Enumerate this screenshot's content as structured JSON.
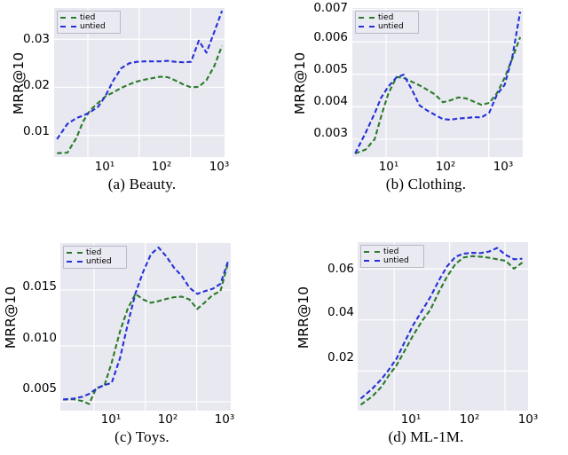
{
  "figure": {
    "subplots": [
      {
        "id": "a",
        "caption": "(a) Beauty.",
        "ylabel": "MRR@10",
        "yticks": [
          "0.01",
          "0.02",
          "0.03"
        ],
        "ytick_values": [
          0.01,
          0.02,
          0.03
        ],
        "xticks": [
          "10¹",
          "10²",
          "10³"
        ],
        "xtick_values": [
          10,
          100,
          1000
        ],
        "legend": [
          "tied",
          "untied"
        ]
      },
      {
        "id": "b",
        "caption": "(b) Clothing.",
        "ylabel": "MRR@10",
        "yticks": [
          "0.003",
          "0.004",
          "0.005",
          "0.006",
          "0.007"
        ],
        "ytick_values": [
          0.003,
          0.004,
          0.005,
          0.006,
          0.007
        ],
        "xticks": [
          "10¹",
          "10²",
          "10³"
        ],
        "xtick_values": [
          10,
          100,
          1000
        ],
        "legend": [
          "tied",
          "untied"
        ]
      },
      {
        "id": "c",
        "caption": "(c) Toys.",
        "ylabel": "MRR@10",
        "yticks": [
          "0.005",
          "0.010",
          "0.015"
        ],
        "ytick_values": [
          0.005,
          0.01,
          0.015
        ],
        "xticks": [
          "10¹",
          "10²",
          "10³"
        ],
        "xtick_values": [
          10,
          100,
          1000
        ],
        "legend": [
          "tied",
          "untied"
        ]
      },
      {
        "id": "d",
        "caption": "(d) ML-1M.",
        "ylabel": "MRR@10",
        "yticks": [
          "0.02",
          "0.04",
          "0.06"
        ],
        "ytick_values": [
          0.02,
          0.04,
          0.06
        ],
        "xticks": [
          "10¹",
          "10²",
          "10³"
        ],
        "xtick_values": [
          10,
          100,
          1000
        ],
        "legend": [
          "tied",
          "untied"
        ]
      }
    ]
  },
  "style": {
    "tied_color": "#2a7a2a",
    "untied_color": "#2430d8",
    "axes_face": "#e8e8f0",
    "grid_color": "#ffffff",
    "page_bg": "#ffffff"
  },
  "chart_data": [
    {
      "type": "line",
      "panel": "a",
      "title": "(a) Beauty.",
      "xlabel": "",
      "ylabel": "MRR@10",
      "xscale": "log",
      "xlim": [
        2.2,
        4600
      ],
      "ylim": [
        0.0055,
        0.0365
      ],
      "grid": true,
      "legend_position": "upper left",
      "xticks": [
        10,
        100,
        1000
      ],
      "yticks": [
        0.01,
        0.02,
        0.03
      ],
      "x": [
        2.5,
        4,
        6,
        8,
        11,
        16,
        22,
        32,
        45,
        64,
        90,
        128,
        180,
        256,
        360,
        512,
        720,
        1024,
        1450,
        2048,
        2900,
        4096
      ],
      "series": [
        {
          "name": "tied",
          "values": [
            0.0063,
            0.0064,
            0.0095,
            0.0128,
            0.0152,
            0.0168,
            0.0181,
            0.019,
            0.0199,
            0.0206,
            0.0212,
            0.0216,
            0.0219,
            0.0222,
            0.0221,
            0.0214,
            0.0206,
            0.02,
            0.0201,
            0.0215,
            0.0244,
            0.0286
          ]
        },
        {
          "name": "untied",
          "values": [
            0.0092,
            0.0124,
            0.0136,
            0.0141,
            0.0148,
            0.016,
            0.0182,
            0.0216,
            0.024,
            0.025,
            0.0253,
            0.0254,
            0.0254,
            0.0254,
            0.0255,
            0.0253,
            0.0252,
            0.0253,
            0.0297,
            0.0272,
            0.0315,
            0.0359
          ]
        }
      ]
    },
    {
      "type": "line",
      "panel": "b",
      "title": "(b) Clothing.",
      "xlabel": "",
      "ylabel": "MRR@10",
      "xscale": "log",
      "xlim": [
        2.2,
        4600
      ],
      "ylim": [
        0.00245,
        0.00705
      ],
      "grid": true,
      "legend_position": "upper left",
      "xticks": [
        10,
        100,
        1000
      ],
      "yticks": [
        0.003,
        0.004,
        0.005,
        0.006,
        0.007
      ],
      "x": [
        2.5,
        4,
        6,
        8,
        11,
        16,
        22,
        32,
        45,
        64,
        90,
        128,
        180,
        256,
        360,
        512,
        720,
        1024,
        1450,
        2048,
        2900,
        4096
      ],
      "series": [
        {
          "name": "tied",
          "values": [
            0.00256,
            0.00268,
            0.003,
            0.0037,
            0.0044,
            0.00492,
            0.00489,
            0.00477,
            0.00466,
            0.00452,
            0.00438,
            0.00414,
            0.0042,
            0.00429,
            0.00426,
            0.00416,
            0.00406,
            0.00412,
            0.00442,
            0.0049,
            0.0055,
            0.00615
          ]
        },
        {
          "name": "untied",
          "values": [
            0.00256,
            0.0032,
            0.0038,
            0.00428,
            0.00462,
            0.00491,
            0.00499,
            0.00452,
            0.00404,
            0.00388,
            0.00375,
            0.00362,
            0.0036,
            0.00364,
            0.00365,
            0.00368,
            0.00367,
            0.00382,
            0.00438,
            0.00468,
            0.00556,
            0.00693
          ]
        }
      ]
    },
    {
      "type": "line",
      "panel": "c",
      "title": "(c) Toys.",
      "xlabel": "",
      "ylabel": "MRR@10",
      "xscale": "log",
      "xlim": [
        2.2,
        4600
      ],
      "ylim": [
        0.0042,
        0.0192
      ],
      "grid": true,
      "legend_position": "upper left",
      "xticks": [
        10,
        100,
        1000
      ],
      "yticks": [
        0.005,
        0.01,
        0.015
      ],
      "x": [
        2.5,
        4,
        6,
        8,
        11,
        16,
        22,
        32,
        45,
        64,
        90,
        128,
        180,
        256,
        360,
        512,
        720,
        1024,
        1450,
        2048,
        2900,
        4096
      ],
      "series": [
        {
          "name": "tied",
          "values": [
            0.0052,
            0.00522,
            0.00505,
            0.0048,
            0.0062,
            0.0065,
            0.0085,
            0.0113,
            0.0133,
            0.01465,
            0.01415,
            0.01385,
            0.014,
            0.0142,
            0.01435,
            0.0144,
            0.01415,
            0.0133,
            0.0139,
            0.01455,
            0.0149,
            0.01745
          ]
        },
        {
          "name": "untied",
          "values": [
            0.0052,
            0.00528,
            0.00545,
            0.0057,
            0.00615,
            0.0065,
            0.00668,
            0.0089,
            0.0119,
            0.0147,
            0.0166,
            0.0182,
            0.0188,
            0.018,
            0.017,
            0.01625,
            0.0152,
            0.01465,
            0.0149,
            0.0151,
            0.01555,
            0.0176
          ]
        }
      ]
    },
    {
      "type": "line",
      "panel": "d",
      "title": "(d) ML-1M.",
      "xlabel": "",
      "ylabel": "MRR@10",
      "xscale": "log",
      "xlim": [
        2.2,
        2600
      ],
      "ylim": [
        0.0045,
        0.0705
      ],
      "grid": true,
      "legend_position": "upper left",
      "xticks": [
        10,
        100,
        1000
      ],
      "yticks": [
        0.02,
        0.04,
        0.06
      ],
      "x": [
        2.5,
        4,
        6,
        8,
        11,
        16,
        22,
        32,
        45,
        64,
        90,
        128,
        180,
        256,
        360,
        512,
        720,
        1024,
        1450,
        2048
      ],
      "series": [
        {
          "name": "tied",
          "values": [
            0.0068,
            0.01,
            0.014,
            0.0183,
            0.0222,
            0.0285,
            0.034,
            0.0397,
            0.044,
            0.051,
            0.057,
            0.062,
            0.0645,
            0.065,
            0.0648,
            0.0644,
            0.0638,
            0.0632,
            0.0601,
            0.0625
          ]
        },
        {
          "name": "untied",
          "values": [
            0.0092,
            0.013,
            0.017,
            0.0205,
            0.0248,
            0.032,
            0.038,
            0.0437,
            0.049,
            0.0555,
            0.061,
            0.0648,
            0.066,
            0.0663,
            0.0662,
            0.0668,
            0.0682,
            0.0655,
            0.0638,
            0.064
          ]
        }
      ]
    }
  ]
}
